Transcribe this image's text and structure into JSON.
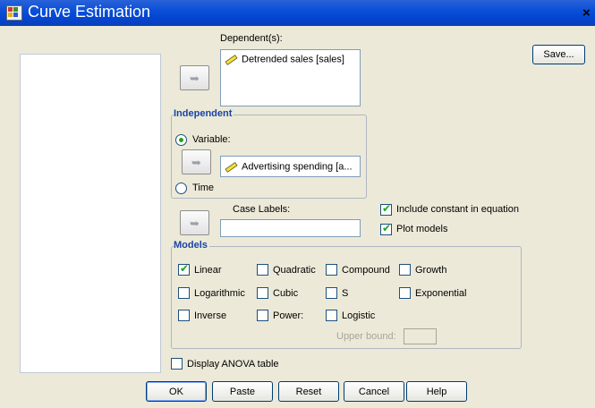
{
  "window": {
    "title": "Curve Estimation",
    "close_glyph": "×",
    "icon": "spss-dialog-icon"
  },
  "dependent": {
    "label": "Dependent(s):",
    "item": "Detrended sales [sales]",
    "item_icon": "scale-variable-icon"
  },
  "independent": {
    "group_title": "Independent",
    "variable_label": "Variable:",
    "variable_selected": true,
    "variable_item": "Advertising spending [a...",
    "variable_item_icon": "scale-variable-icon",
    "time_label": "Time"
  },
  "case_labels": {
    "label": "Case Labels:",
    "value": ""
  },
  "options": {
    "include_constant": {
      "label": "Include constant in equation",
      "checked": true
    },
    "plot_models": {
      "label": "Plot models",
      "checked": true
    }
  },
  "models": {
    "group_title": "Models",
    "items": [
      {
        "label": "Linear",
        "checked": true
      },
      {
        "label": "Quadratic",
        "checked": false
      },
      {
        "label": "Compound",
        "checked": false
      },
      {
        "label": "Growth",
        "checked": false
      },
      {
        "label": "Logarithmic",
        "checked": false
      },
      {
        "label": "Cubic",
        "checked": false
      },
      {
        "label": "S",
        "checked": false
      },
      {
        "label": "Exponential",
        "checked": false
      },
      {
        "label": "Inverse",
        "checked": false
      },
      {
        "label": "Power:",
        "checked": false
      },
      {
        "label": "Logistic",
        "checked": false
      }
    ],
    "upper_bound_label": "Upper bound:",
    "upper_bound_value": ""
  },
  "display_anova": {
    "label": "Display ANOVA table",
    "checked": false
  },
  "buttons": {
    "save": "Save...",
    "ok": "OK",
    "paste": "Paste",
    "reset": "Reset",
    "cancel": "Cancel",
    "help": "Help"
  },
  "arrow_glyph": "➥",
  "colors": {
    "titlebar": "#0a4fd8",
    "group_title": "#1a44a8",
    "check_mark": "#21a121",
    "dialog_bg": "#ece9d8"
  }
}
